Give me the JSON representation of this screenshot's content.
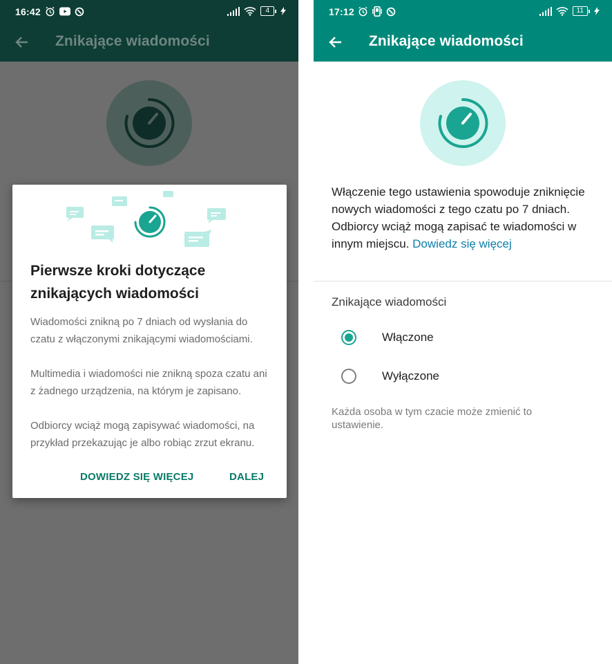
{
  "left_screen": {
    "status_time": "16:42",
    "battery": "4",
    "appbar_title": "Znikające wiadomości",
    "dialog": {
      "title": "Pierwsze kroki dotyczące znikających wiadomości",
      "p1": "Wiadomości znikną po 7 dniach od wysłania do czatu z włączonymi znikającymi wiadomościami.",
      "p2": "Multimedia i wiadomości nie znikną spoza czatu ani z żadnego urządzenia, na którym je zapisano.",
      "p3": "Odbiorcy wciąż mogą zapisywać wiadomości, na przykład przekazując je albo robiąc zrzut ekranu.",
      "btn_more": "DOWIEDZ SIĘ WIĘCEJ",
      "btn_next": "DALEJ"
    }
  },
  "right_screen": {
    "status_time": "17:12",
    "battery": "11",
    "appbar_title": "Znikające wiadomości",
    "description": "Włączenie tego ustawienia spowoduje zniknięcie nowych wiadomości z tego czatu po 7 dniach. Odbiorcy wciąż mogą zapisać te wiadomości w innym miejscu.",
    "description_link": "Dowiedz się więcej",
    "section_title": "Znikające wiadomości",
    "options": [
      {
        "label": "Włączone",
        "selected": true
      },
      {
        "label": "Wyłączone",
        "selected": false
      }
    ],
    "note": "Każda osoba w tym czacie może zmienić to ustawienie."
  },
  "colors": {
    "accent": "#00897a",
    "accent_dark_dimmed": "#0d3d34",
    "radio_on": "#1aa592",
    "link": "#0b7fa8"
  }
}
